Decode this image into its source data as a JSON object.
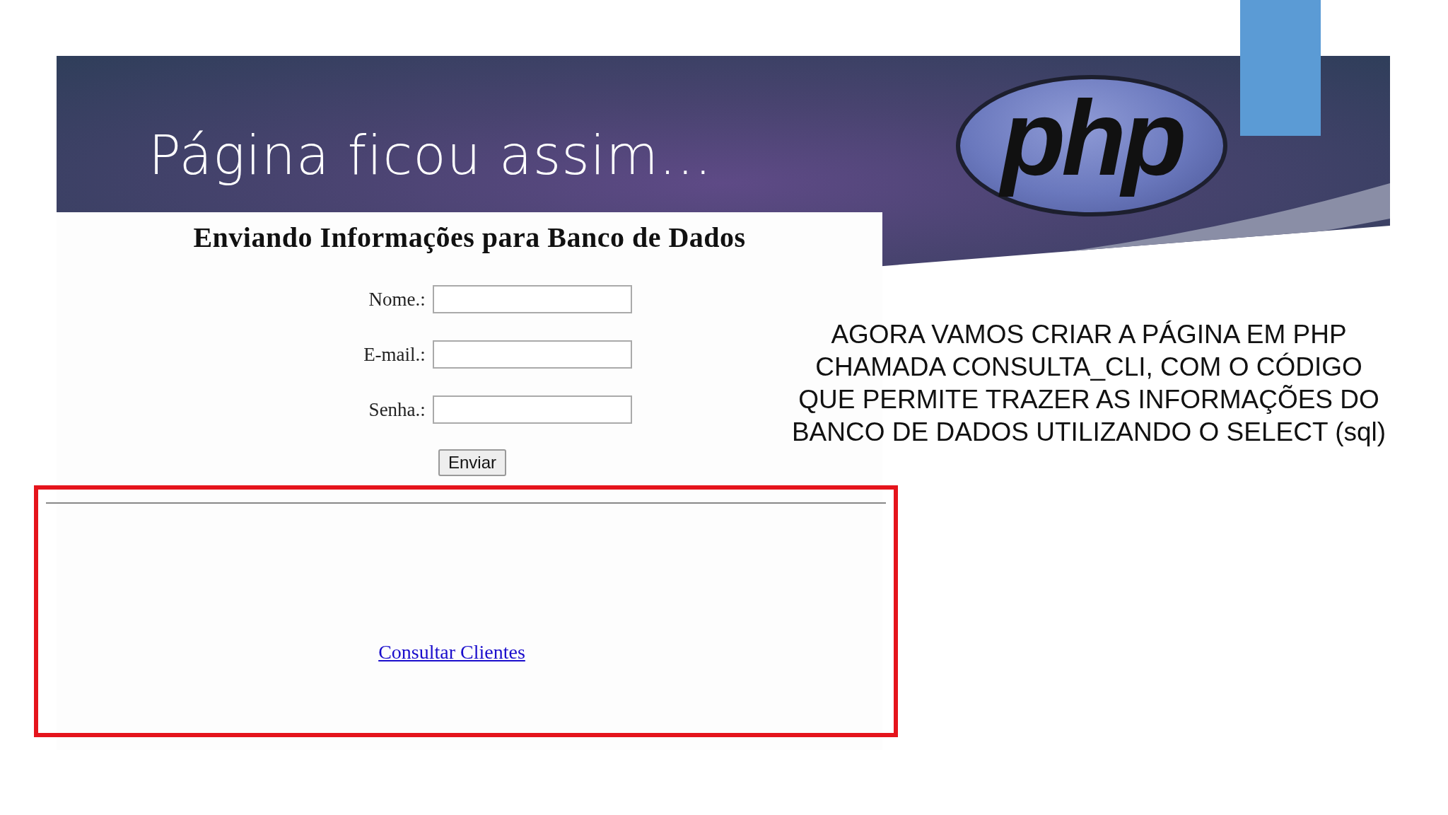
{
  "slide": {
    "title": "Página ficou assim...",
    "logo": "php"
  },
  "web_page": {
    "heading": "Enviando Informações para Banco de Dados",
    "fields": [
      {
        "label": "Nome.:"
      },
      {
        "label": "E-mail.:"
      },
      {
        "label": "Senha.:"
      }
    ],
    "button": "Enviar",
    "link": "Consultar Clientes"
  },
  "note": [
    "AGORA VAMOS CRIAR A PÁGINA EM PHP",
    "CHAMADA CONSULTA_CLI, COM O CÓDIGO",
    "QUE PERMITE TRAZER AS INFORMAÇÕES DO",
    "BANCO DE DADOS UTILIZANDO O SELECT (sql)"
  ]
}
